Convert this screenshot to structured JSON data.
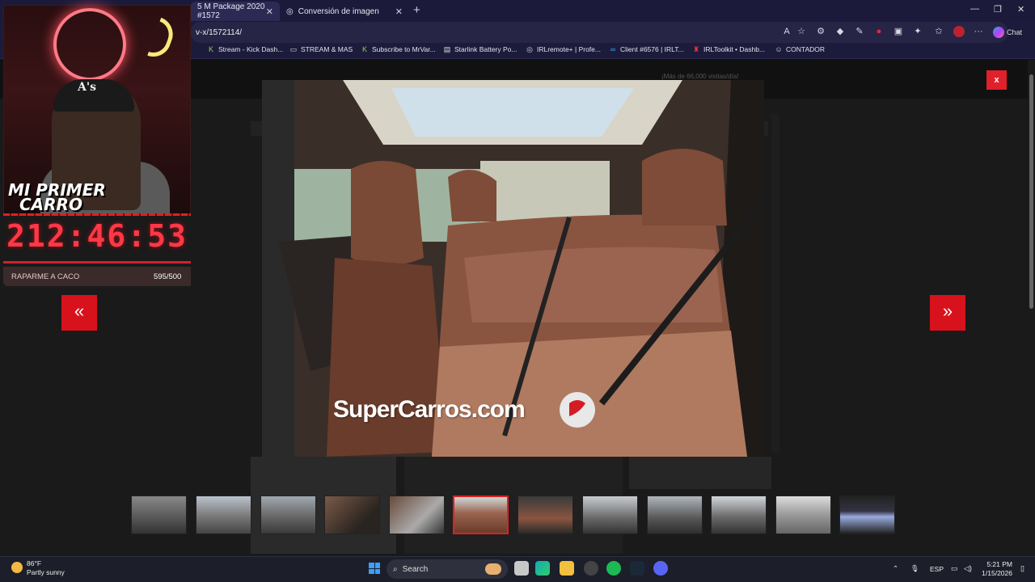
{
  "browser": {
    "tabs": [
      {
        "title": "5 M Package 2020 #1572",
        "active": true
      },
      {
        "title": "Conversión de imagen",
        "active": false
      }
    ],
    "url": "v-x/1572114/",
    "chat_label": "Chat",
    "bookmarks": [
      {
        "label": "Stream - Kick Dash...",
        "icon": "kick-icon"
      },
      {
        "label": "STREAM & MAS",
        "icon": "folder-icon"
      },
      {
        "label": "Subscribe to MrVar...",
        "icon": "kick-icon"
      },
      {
        "label": "Starlink Battery Po...",
        "icon": "page-icon"
      },
      {
        "label": "IRLremote+ | Profe...",
        "icon": "globe-icon"
      },
      {
        "label": "Client #6576 | IRLT...",
        "icon": "link-icon"
      },
      {
        "label": "IRLToolkit • Dashb...",
        "icon": "irltoolkit-icon"
      },
      {
        "label": "CONTADOR",
        "icon": "contador-icon"
      }
    ]
  },
  "overlay": {
    "banner_line1": "MI PRIMER",
    "banner_line2": "CARRO",
    "cap_text": "A's",
    "timer": "212:46:53",
    "goal_label": "RAPARME A CACO",
    "goal_count": "595/500",
    "goal_progress": 1.0
  },
  "page": {
    "visits_text": "¡Más de 66,000 visitas/día!"
  },
  "lightbox": {
    "close_label": "x",
    "prev_label": "«",
    "next_label": "»",
    "watermark": "SuperCarros.com",
    "thumbnail_count": 12,
    "active_thumbnail": 6
  },
  "taskbar": {
    "weather_temp": "86°F",
    "weather_desc": "Partly sunny",
    "search_placeholder": "Search",
    "language": "ESP",
    "time": "5:21 PM",
    "date": "1/15/2026"
  }
}
